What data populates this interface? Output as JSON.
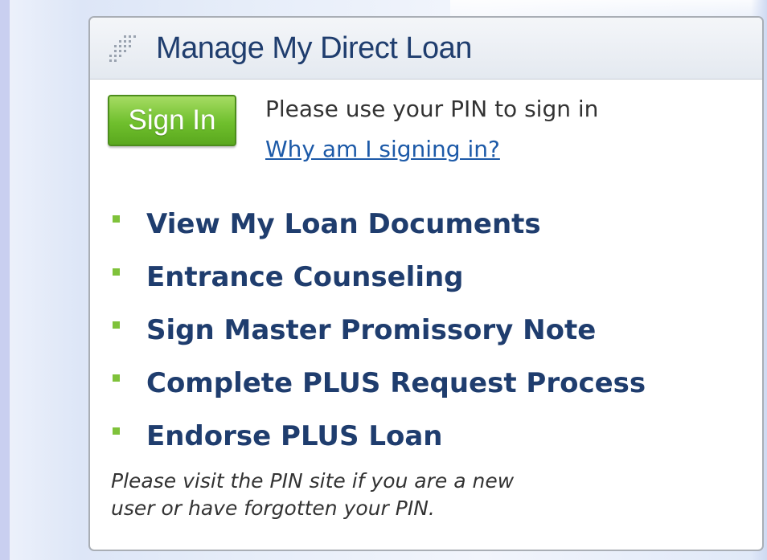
{
  "panel": {
    "title": "Manage My Direct Loan"
  },
  "signin": {
    "button_label": "Sign In",
    "instruction": "Please use your PIN to sign in",
    "help_link": "Why am I signing in?"
  },
  "links": [
    {
      "label": "View My Loan Documents"
    },
    {
      "label": "Entrance Counseling"
    },
    {
      "label": "Sign Master Promissory Note"
    },
    {
      "label": "Complete PLUS Request Process"
    },
    {
      "label": "Endorse PLUS Loan"
    }
  ],
  "footer": {
    "line1": "Please visit the PIN site if you are a new",
    "line2": "user or have forgotten your PIN."
  },
  "colors": {
    "title_text": "#1f3d6e",
    "link_text": "#1f3d6e",
    "help_link": "#1d5aa8",
    "signin_button": "#6fbf2d",
    "bullet": "#7fc23a"
  },
  "icons": {
    "header": "dotted-grid-icon",
    "bullet": "square-bullet-icon"
  }
}
